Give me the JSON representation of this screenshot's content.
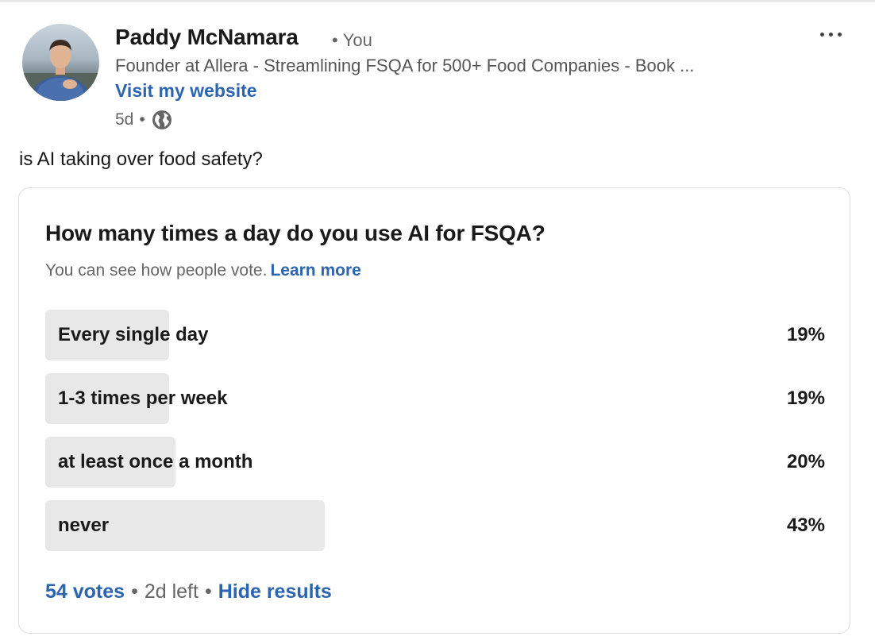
{
  "post": {
    "author": {
      "name": "Paddy McNamara",
      "relation": "You",
      "headline": "Founder at Allera - Streamlining FSQA for 500+ Food Companies - Book ...",
      "website_link": "Visit my website",
      "age": "5d",
      "visibility_icon": "globe-icon"
    },
    "menu_icon": "more-icon",
    "text": "is AI taking over food safety?"
  },
  "poll": {
    "question": "How many times a day do you use AI for FSQA?",
    "visibility_note": "You can see how people vote.",
    "learn_more": "Learn more",
    "options": [
      {
        "label": "Every single day",
        "percent_label": "19%",
        "share": 0.19
      },
      {
        "label": "1-3 times per week",
        "percent_label": "19%",
        "share": 0.19
      },
      {
        "label": "at least once a month",
        "percent_label": "20%",
        "share": 0.2
      },
      {
        "label": "never",
        "percent_label": "43%",
        "share": 0.43
      }
    ],
    "footer": {
      "votes": "54 votes",
      "time_left": "2d left",
      "hide_results": "Hide results"
    }
  },
  "colors": {
    "link": "#2b64b0",
    "result_bar": "#e8e8e8",
    "text_primary": "#1a1a1a",
    "text_secondary": "#666666"
  }
}
